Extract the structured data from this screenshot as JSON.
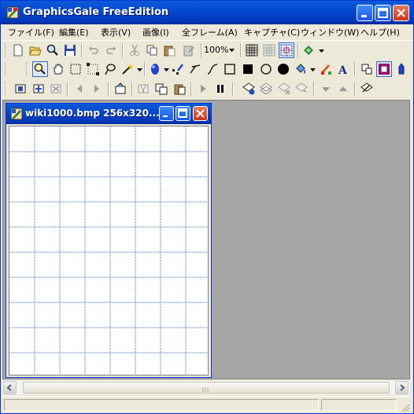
{
  "window": {
    "title": "GraphicsGale FreeEdition"
  },
  "menu": [
    "ファイル(F)",
    "編集(E)",
    "表示(V)",
    "画像(I)",
    "全フレーム(A)",
    "キャプチャ(C)",
    "ウィンドウ(W)",
    "ヘルプ(H)"
  ],
  "toolbar": {
    "zoom_value": "100%"
  },
  "child_window": {
    "title": "wiki1000.bmp 256x320..."
  },
  "colors": {
    "titlebar": "#0447cf",
    "grid": "#3d6fd6",
    "workspace": "#a6a6a6"
  }
}
